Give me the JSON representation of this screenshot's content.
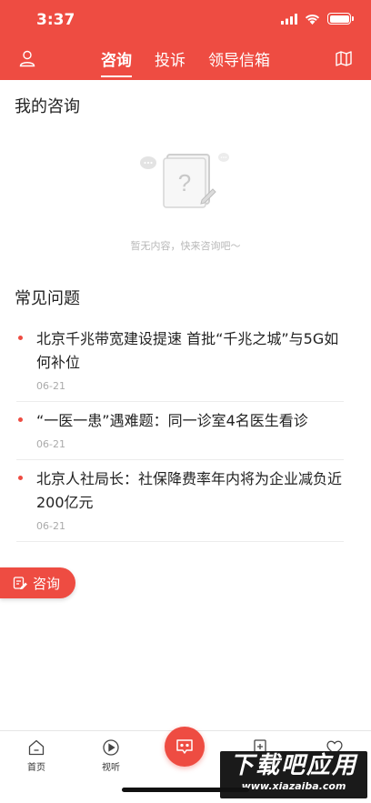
{
  "status_bar": {
    "time": "3:37"
  },
  "header": {
    "tabs": [
      {
        "label": "咨询",
        "active": true
      },
      {
        "label": "投诉",
        "active": false
      },
      {
        "label": "领导信箱",
        "active": false
      }
    ]
  },
  "my_consult": {
    "title": "我的咨询",
    "empty_text": "暂无内容，快来咨询吧～"
  },
  "faq": {
    "title": "常见问题",
    "items": [
      {
        "title": "北京千兆带宽建设提速 首批“千兆之城”与5G如何补位",
        "date": "06-21"
      },
      {
        "title": "“一医一患”遇难题：同一诊室4名医生看诊",
        "date": "06-21"
      },
      {
        "title": "北京人社局长：社保降费率年内将为企业减负近200亿元",
        "date": "06-21"
      }
    ]
  },
  "consult_button": {
    "label": "咨询"
  },
  "bottom_nav": {
    "items": [
      {
        "label": "首页",
        "icon": "home-icon"
      },
      {
        "label": "视听",
        "icon": "play-icon"
      }
    ]
  },
  "watermark": {
    "text": "下载吧应用",
    "url": "www.xiazaiba.com"
  },
  "colors": {
    "brand": "#ee4c42"
  }
}
